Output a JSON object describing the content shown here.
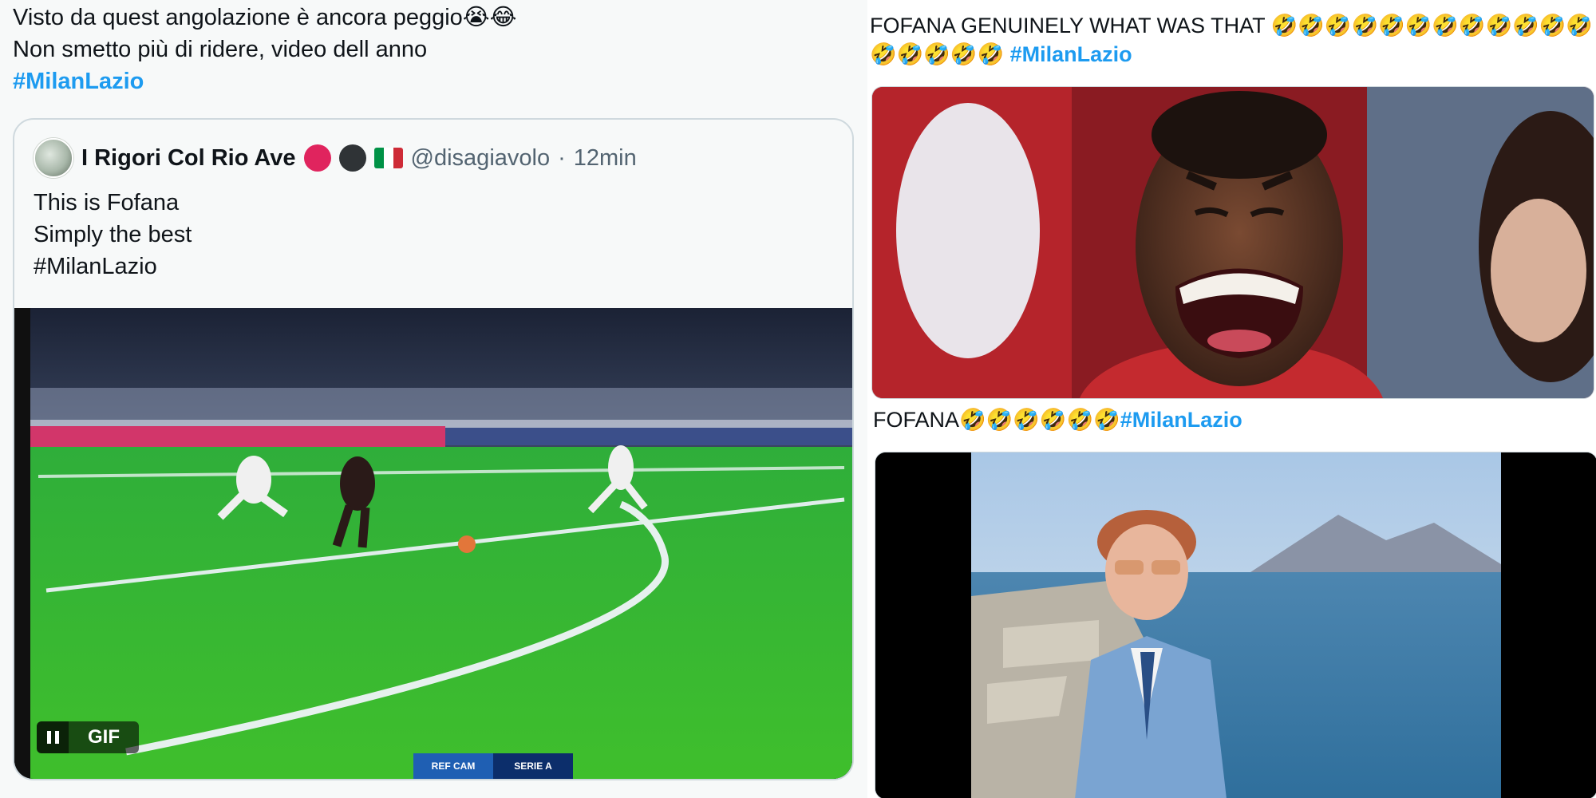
{
  "left_tweet": {
    "text_lines": [
      "Visto da quest angolazione è ancora peggio😭😂",
      "Non smetto più di ridere, video dell anno"
    ],
    "hashtag": "#MilanLazio",
    "quote": {
      "display_name": "I Rigori Col Rio Ave",
      "handle": "@disagiavolo",
      "separator": "·",
      "time": "12min",
      "body_lines": [
        "This is Fofana",
        "Simply the best",
        "#MilanLazio"
      ],
      "media": {
        "badge_label": "GIF",
        "scoreboard": [
          "REF CAM",
          "SERIE A"
        ]
      }
    }
  },
  "right_top_tweet": {
    "text_line1": "FOFANA GENUINELY WHAT WAS THAT 🤣🤣🤣🤣🤣🤣🤣🤣🤣🤣🤣🤣",
    "text_line2_emoji": "🤣🤣🤣🤣🤣",
    "hashtag": "#MilanLazio"
  },
  "right_bottom_tweet": {
    "text": "FOFANA🤣🤣🤣🤣🤣🤣",
    "hashtag": "#MilanLazio"
  },
  "colors": {
    "hashtag": "#1d9bf0",
    "secondary_text": "#536471",
    "card_border": "#cfd9de",
    "panel_bg_left": "#f7f9f9",
    "panel_bg_right": "#ffffff",
    "flag_red": "#e0245e",
    "flag_dark": "#2f3336",
    "italy_green": "#009246",
    "italy_white": "#ffffff",
    "italy_red": "#ce2b37"
  },
  "icons": [
    "pause-icon",
    "avatar-icon",
    "red-circle-icon",
    "black-circle-icon",
    "italy-flag-icon"
  ]
}
